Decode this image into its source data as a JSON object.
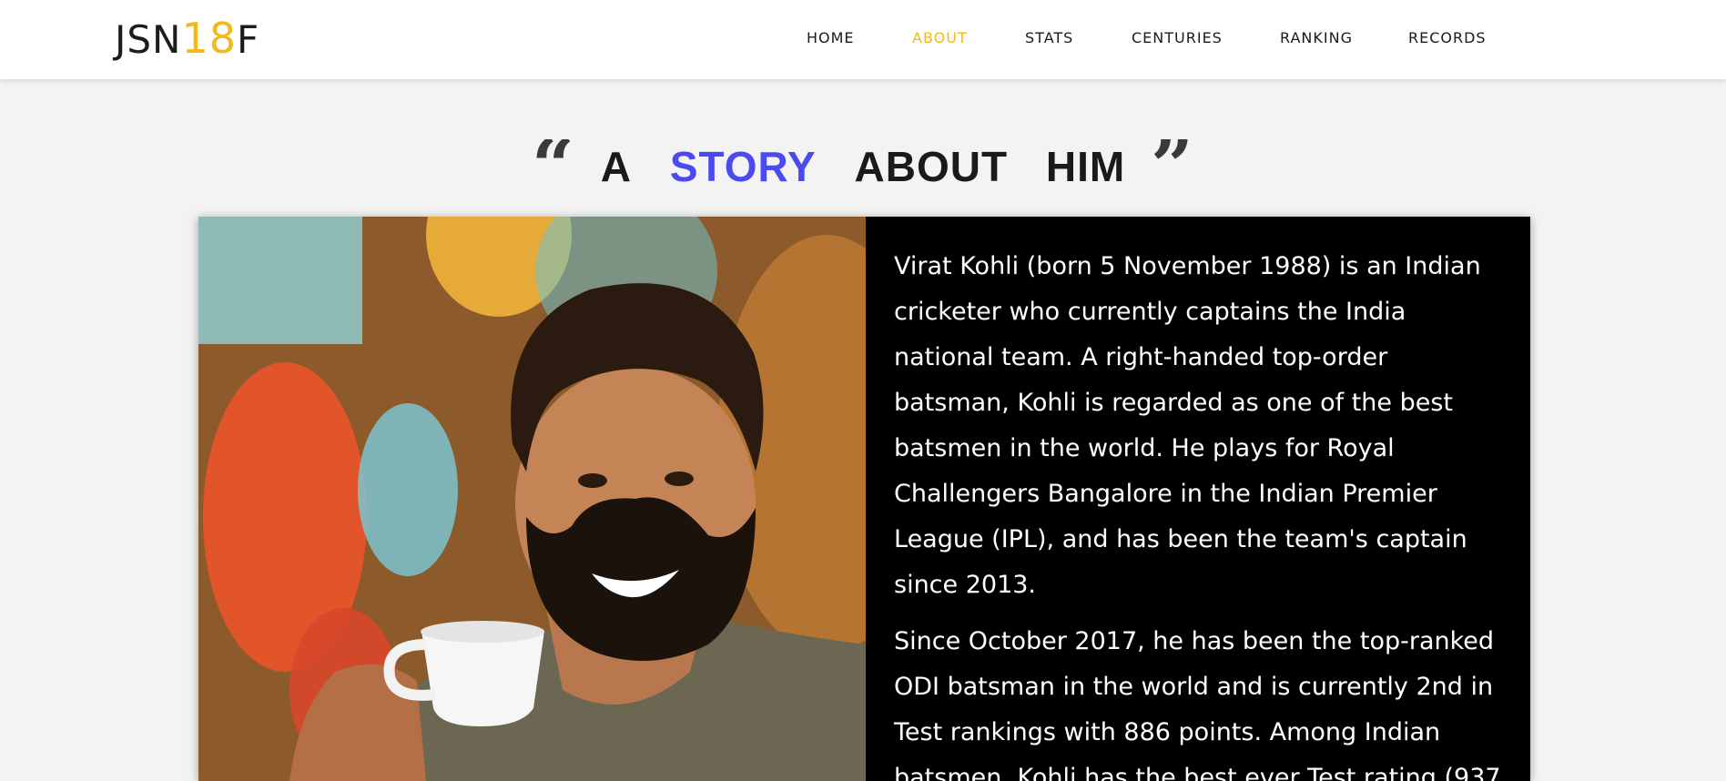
{
  "brand": {
    "prefix": "JSN",
    "accent": "18",
    "suffix": "F"
  },
  "nav": {
    "items": [
      {
        "label": "HOME",
        "active": false
      },
      {
        "label": "ABOUT",
        "active": true
      },
      {
        "label": "STATS",
        "active": false
      },
      {
        "label": "CENTURIES",
        "active": false
      },
      {
        "label": "RANKING",
        "active": false
      },
      {
        "label": "RECORDS",
        "active": false
      }
    ]
  },
  "heading": {
    "word1": "A",
    "highlight": "STORY",
    "word3": "ABOUT",
    "word4": "HIM",
    "open_icon": "quote-left-icon",
    "close_icon": "quote-right-icon"
  },
  "photo": {
    "subject": "man holding a white tea cup, smiling"
  },
  "bio": {
    "paragraph1": "Virat Kohli (born 5 November 1988) is an Indian cricketer who currently captains the India national team. A right-handed top-order batsman, Kohli is regarded as one of the best batsmen in the world. He plays for Royal Challengers Bangalore in the Indian Premier League (IPL), and has been the team's captain since 2013.",
    "paragraph2": "Since October 2017, he has been the top-ranked ODI batsman in the world and is currently 2nd in Test rankings with 886 points. Among Indian batsmen, Kohli has the best ever Test rating (937"
  },
  "colors": {
    "accent_yellow": "#f3b91a",
    "heading_highlight": "#4b4af0",
    "bio_background": "#000000",
    "page_background": "#f3f3f3"
  }
}
